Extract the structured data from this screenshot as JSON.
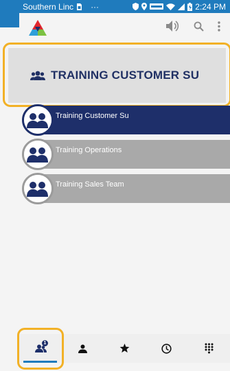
{
  "status_bar": {
    "carrier": "Southern Linc",
    "dots": "···",
    "time": "2:24 PM"
  },
  "header": {
    "title": "TRAINING CUSTOMER SU"
  },
  "groups": [
    {
      "label": "Training Customer Su",
      "active": true
    },
    {
      "label": "Training Operations",
      "active": false
    },
    {
      "label": "Training Sales Team",
      "active": false
    }
  ],
  "bottom_nav": {
    "badge_count": "1",
    "tabs": [
      "groups",
      "contacts",
      "favorites",
      "history",
      "dialpad"
    ],
    "active_tab": "groups"
  },
  "colors": {
    "status_bar": "#1f7bbd",
    "active_item": "#1e2f6a",
    "inactive_item": "#a9a9a9",
    "highlight": "#f2b126"
  }
}
